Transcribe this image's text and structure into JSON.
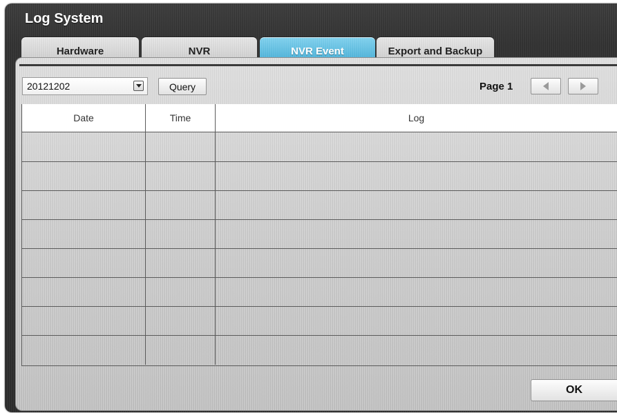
{
  "window": {
    "title": "Log System"
  },
  "tabs": [
    {
      "label": "Hardware",
      "active": false
    },
    {
      "label": "NVR",
      "active": false
    },
    {
      "label": "NVR Event",
      "active": true
    },
    {
      "label": "Export and Backup",
      "active": false
    }
  ],
  "filter": {
    "date_value": "20121202",
    "query_label": "Query"
  },
  "pagination": {
    "page_label": "Page 1"
  },
  "table": {
    "columns": [
      "Date",
      "Time",
      "Log"
    ],
    "rows": [
      {
        "date": "",
        "time": "",
        "log": ""
      },
      {
        "date": "",
        "time": "",
        "log": ""
      },
      {
        "date": "",
        "time": "",
        "log": ""
      },
      {
        "date": "",
        "time": "",
        "log": ""
      },
      {
        "date": "",
        "time": "",
        "log": ""
      },
      {
        "date": "",
        "time": "",
        "log": ""
      },
      {
        "date": "",
        "time": "",
        "log": ""
      },
      {
        "date": "",
        "time": "",
        "log": ""
      }
    ]
  },
  "footer": {
    "ok_label": "OK"
  },
  "colors": {
    "active_tab": "#3fa9d3",
    "window_bg": "#2f2f2f",
    "panel_bg": "#cfcfcf",
    "grid_line": "#5a5a5a"
  }
}
